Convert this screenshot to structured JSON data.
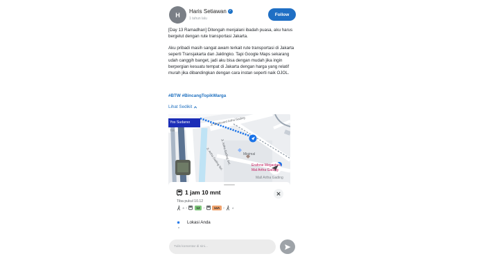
{
  "post": {
    "author": {
      "avatar_initial": "H",
      "name": "Haris Setiawan",
      "verified_icon": "check-badge-icon",
      "time_ago": "1 tahun lalu"
    },
    "follow_label": "Follow",
    "paragraphs": [
      "[Day 13 Ramadhan] Ditengah menjalani ibadah puasa, aku harus bergelut dengan rute transportasi Jakarta.",
      "Aku pribadi masih sangat awam terkait rute transportasi di Jakarta seperti Transjakarta dan Jaklingko. Tapi Google Maps sekarang udah canggih banget, jadi aku bisa dengan mudah jika ingin berpergian kesuatu tempat di Jakarta dengan harga yang relatif murah jika dibandingkan dengan cara instan seperti naik OJOL."
    ],
    "hashtags": "#BTW #BincangTopikWarga",
    "show_less_label": "Lihat Sedikit"
  },
  "map": {
    "labels": {
      "area": "Yos Sudarso",
      "street_main": "Jl. Boulevard Artha Gading",
      "street_side": "Jl. Artha Gading Sel.",
      "street_side2": "Jl. Artha Gading Sel.",
      "poi_minimal": "Minimal",
      "poi_erafone": "Erafone Megastore",
      "poi_erafone2": "Mal Artha Gading",
      "poi_mall": "Mall Artha Gading",
      "tbk": "Tbk"
    },
    "colors": {
      "route": "#1a73e8",
      "transit_road": "#2f5f8f",
      "area_label_bg": "#1b2db7"
    }
  },
  "directions": {
    "duration": "1 jam 10 mnt",
    "arrival": "Tiba pukul 10.12",
    "steps": [
      {
        "type": "walk",
        "minutes": "8"
      },
      {
        "type": "bus",
        "route": "12",
        "color": "#7cc67a"
      },
      {
        "type": "bus",
        "route": "14A",
        "color": "#f0a36d"
      },
      {
        "type": "walk",
        "minutes": "4"
      }
    ],
    "origin": "Lokasi Anda"
  },
  "comment": {
    "placeholder": "Tulis komentar di sini..."
  }
}
